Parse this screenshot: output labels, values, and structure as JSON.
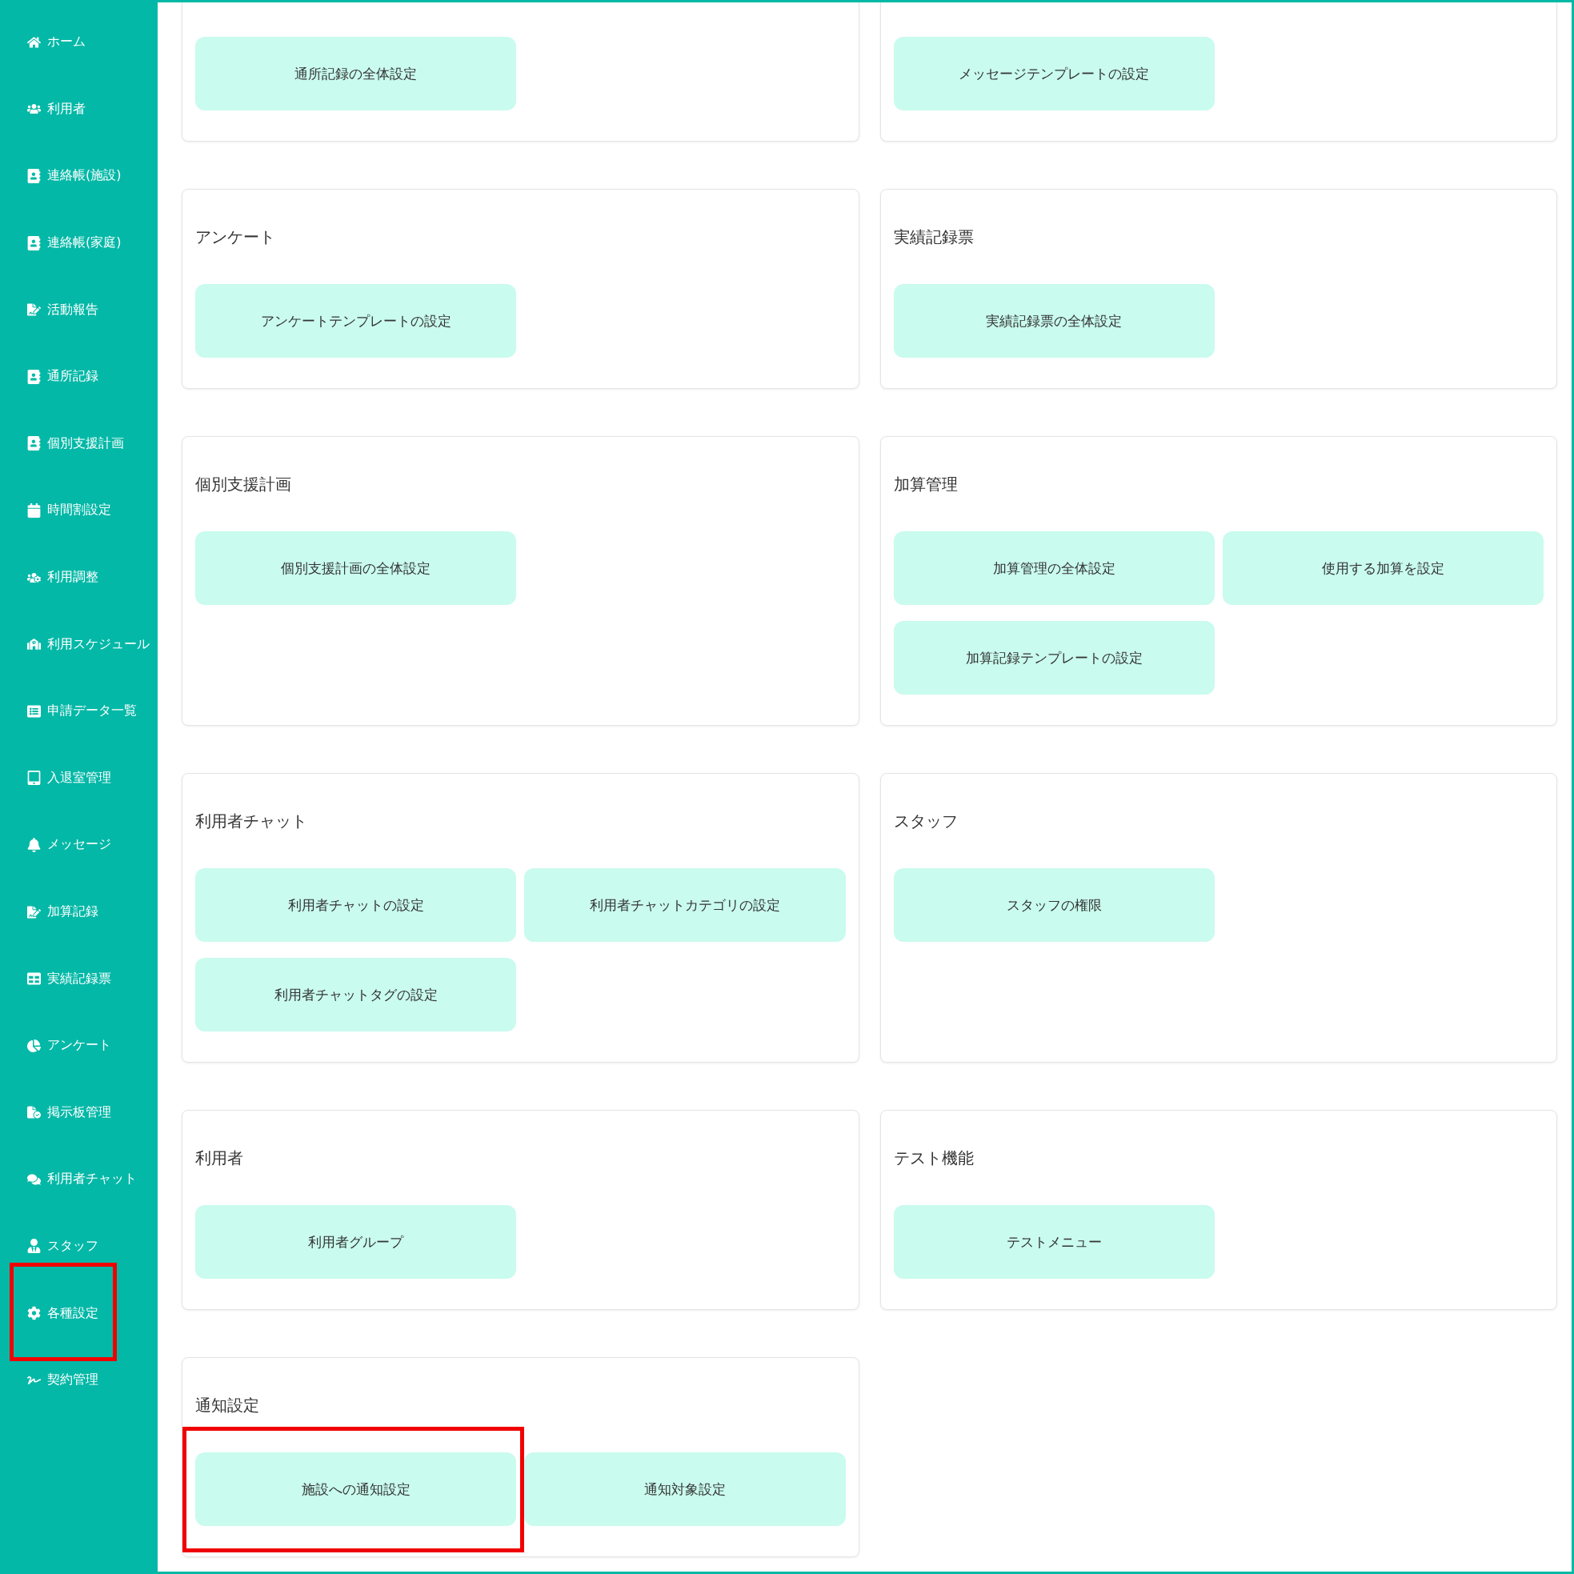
{
  "sidebar": {
    "items": [
      {
        "label": "ホーム",
        "highlighted": false
      },
      {
        "label": "利用者",
        "highlighted": false
      },
      {
        "label": "連絡帳(施設)",
        "highlighted": false
      },
      {
        "label": "連絡帳(家庭)",
        "highlighted": false
      },
      {
        "label": "活動報告",
        "highlighted": false
      },
      {
        "label": "通所記録",
        "highlighted": false
      },
      {
        "label": "個別支援計画",
        "highlighted": false
      },
      {
        "label": "時間割設定",
        "highlighted": false
      },
      {
        "label": "利用調整",
        "highlighted": false
      },
      {
        "label": "利用スケジュール",
        "highlighted": false
      },
      {
        "label": "申請データ一覧",
        "highlighted": false
      },
      {
        "label": "入退室管理",
        "highlighted": false
      },
      {
        "label": "メッセージ",
        "highlighted": false
      },
      {
        "label": "加算記録",
        "highlighted": false
      },
      {
        "label": "実績記録票",
        "highlighted": false
      },
      {
        "label": "アンケート",
        "highlighted": false
      },
      {
        "label": "掲示板管理",
        "highlighted": false
      },
      {
        "label": "利用者チャット",
        "highlighted": false
      },
      {
        "label": "スタッフ",
        "highlighted": false
      },
      {
        "label": "各種設定",
        "highlighted": true
      },
      {
        "label": "契約管理",
        "highlighted": false
      }
    ]
  },
  "sections": [
    {
      "buttons": [
        {
          "label": "通所記録の全体設定",
          "highlighted": false
        }
      ]
    },
    {
      "buttons": [
        {
          "label": "メッセージテンプレートの設定",
          "highlighted": false
        }
      ]
    },
    {
      "title": "アンケート",
      "buttons": [
        {
          "label": "アンケートテンプレートの設定",
          "highlighted": false
        }
      ]
    },
    {
      "title": "実績記録票",
      "buttons": [
        {
          "label": "実績記録票の全体設定",
          "highlighted": false
        }
      ]
    },
    {
      "title": "個別支援計画",
      "buttons": [
        {
          "label": "個別支援計画の全体設定",
          "highlighted": false
        }
      ]
    },
    {
      "title": "加算管理",
      "buttons": [
        {
          "label": "加算管理の全体設定",
          "highlighted": false
        },
        {
          "label": "使用する加算を設定",
          "highlighted": false
        },
        {
          "label": "加算記録テンプレートの設定",
          "highlighted": false
        }
      ]
    },
    {
      "title": "利用者チャット",
      "buttons": [
        {
          "label": "利用者チャットの設定",
          "highlighted": false
        },
        {
          "label": "利用者チャットカテゴリの設定",
          "highlighted": false
        },
        {
          "label": "利用者チャットタグの設定",
          "highlighted": false
        }
      ]
    },
    {
      "title": "スタッフ",
      "buttons": [
        {
          "label": "スタッフの権限",
          "highlighted": false
        }
      ]
    },
    {
      "title": "利用者",
      "buttons": [
        {
          "label": "利用者グループ",
          "highlighted": false
        }
      ]
    },
    {
      "title": "テスト機能",
      "buttons": [
        {
          "label": "テストメニュー",
          "highlighted": false
        }
      ]
    },
    {
      "title": "通知設定",
      "buttons": [
        {
          "label": "施設への通知設定",
          "highlighted": true
        },
        {
          "label": "通知対象設定",
          "highlighted": false
        }
      ]
    }
  ]
}
